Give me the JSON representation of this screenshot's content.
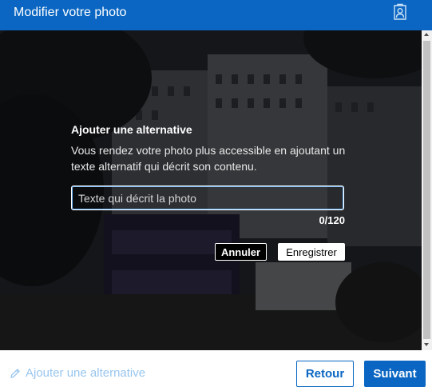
{
  "header": {
    "title": "Modifier votre photo",
    "icon": "person-frame-icon"
  },
  "alt_dialog": {
    "title": "Ajouter une alternative",
    "description": "Vous rendez votre photo plus accessible en ajoutant un texte alternatif qui décrit son contenu.",
    "input_value": "",
    "input_placeholder": "Texte qui décrit la photo",
    "counter": "0/120",
    "cancel_label": "Annuler",
    "save_label": "Enregistrer"
  },
  "footer": {
    "add_alt_label": "Ajouter une alternative",
    "add_alt_icon": "pencil-icon",
    "back_label": "Retour",
    "next_label": "Suivant"
  },
  "colors": {
    "brand": "#0a66c2",
    "link_light": "#98c5ee"
  }
}
